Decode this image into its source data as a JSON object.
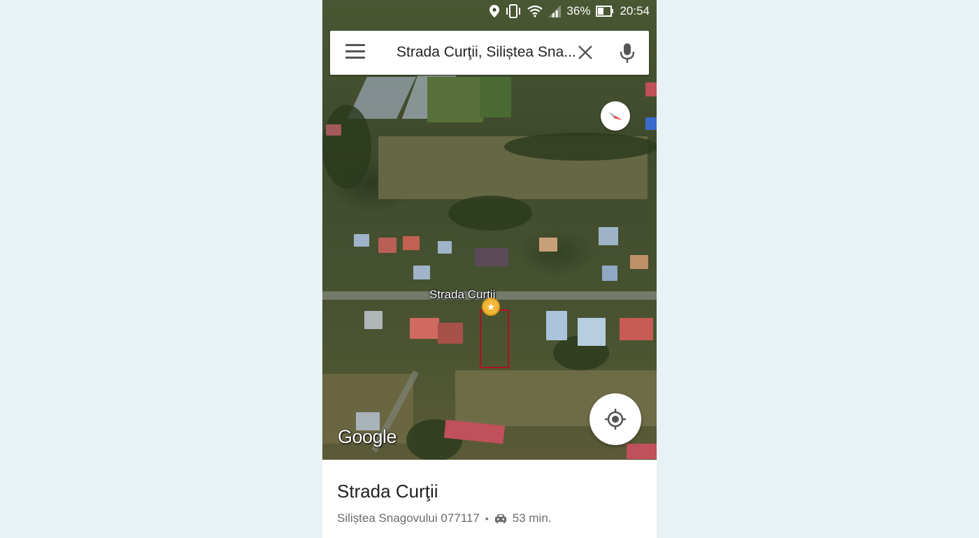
{
  "status_bar": {
    "battery": "36%",
    "time": "20:54"
  },
  "search": {
    "query": "Strada Curţii, Siliștea Sna..."
  },
  "map": {
    "street_label": "Strada Curţii",
    "attribution": "Google"
  },
  "place": {
    "title": "Strada Curţii",
    "address": "Siliștea Snagovului 077117",
    "separator": "•",
    "drive_time": "53 min."
  },
  "colors": {
    "pin": "#f2b636",
    "parcel_outline": "#b01020",
    "background": "#e8f2f4"
  }
}
